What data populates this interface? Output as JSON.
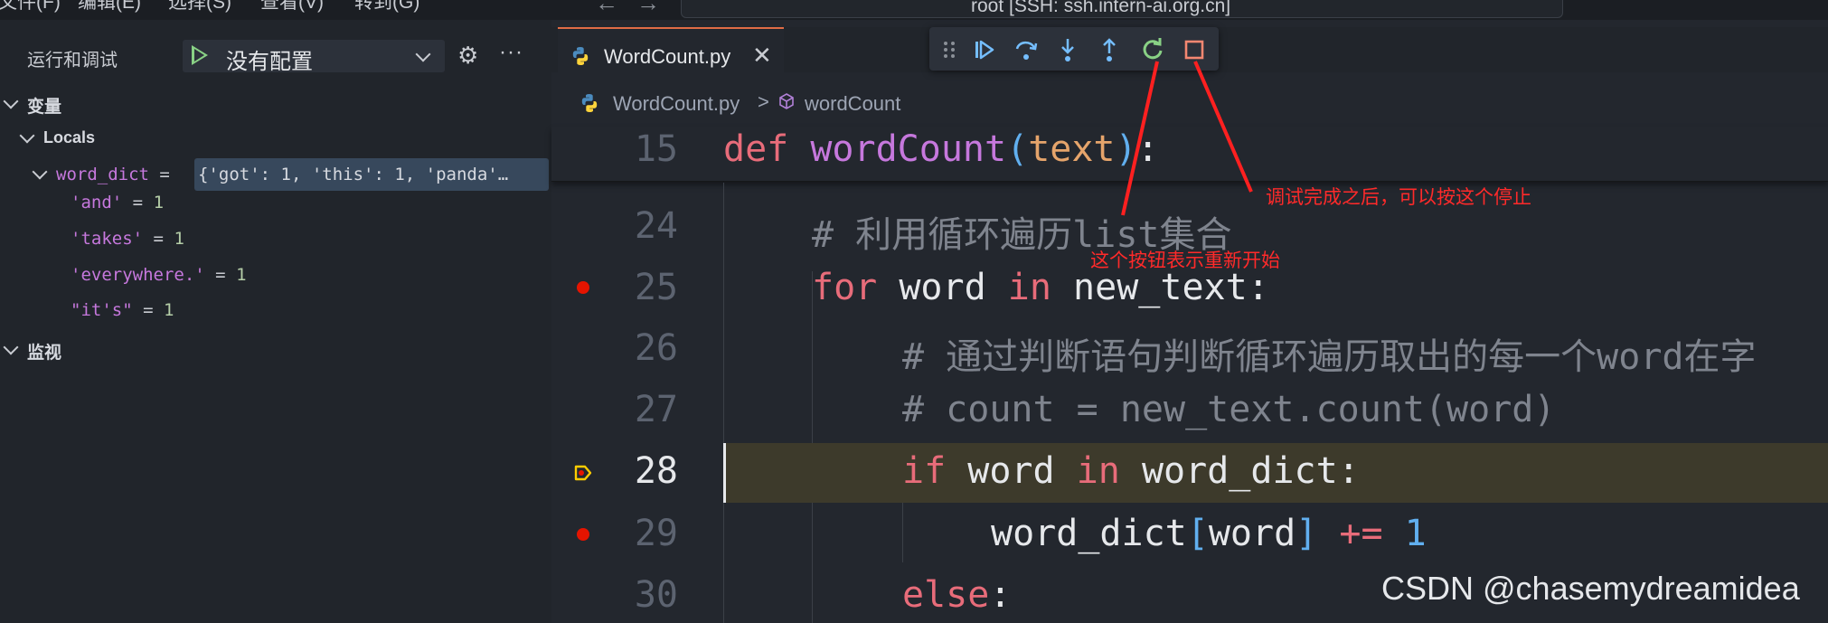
{
  "menubar": {
    "items": [
      "文件(F)",
      "编辑(E)",
      "选择(S)",
      "查看(V)",
      "转到(G)"
    ],
    "more": "···",
    "search": "root [SSH: ssh.intern-ai.org.cn]"
  },
  "sidebar": {
    "title": "运行和调试",
    "config_label": "没有配置",
    "sections": {
      "variables": "变量",
      "locals": "Locals",
      "watch": "监视"
    },
    "variables": [
      {
        "name": "word_dict",
        "eq": "=",
        "value": "{'got': 1, 'this': 1, 'panda'…"
      },
      {
        "name": "'and'",
        "eq": "=",
        "value": "1"
      },
      {
        "name": "'takes'",
        "eq": "=",
        "value": "1"
      },
      {
        "name": "'everywhere.'",
        "eq": "=",
        "value": "1"
      },
      {
        "name": "\"it's\"",
        "eq": "=",
        "value": "1"
      }
    ]
  },
  "editor": {
    "tab_label": "WordCount.py",
    "breadcrumb": {
      "file": "WordCount.py",
      "separator": ">",
      "symbol": "wordCount"
    },
    "lines": [
      {
        "num": "15"
      },
      {
        "num": "24"
      },
      {
        "num": "25"
      },
      {
        "num": "26"
      },
      {
        "num": "27"
      },
      {
        "num": "28"
      },
      {
        "num": "29"
      },
      {
        "num": "30"
      }
    ],
    "code": {
      "l15": {
        "kw": "def",
        "fn": "wordCount",
        "open": "(",
        "param": "text",
        "close": ")",
        "colon": ":"
      },
      "l24": "# 利用循环遍历list集合",
      "l25": {
        "kw": "for",
        "a": "word",
        "in": "in",
        "b": "new_text:"
      },
      "l26": "# 通过判断语句判断循环遍历取出的每一个word在字",
      "l27": "# count = new_text.count(word)",
      "l28": {
        "kw": "if",
        "a": "word",
        "in": "in",
        "b": "word_dict:"
      },
      "l29": {
        "a": "word_dict",
        "open": "[",
        "b": "word",
        "close": "]",
        "op": "+=",
        "num": "1"
      },
      "l30": {
        "kw": "else",
        "colon": ":"
      }
    }
  },
  "annotations": {
    "stop_note": "调试完成之后，可以按这个停止",
    "restart_note": "这个按钮表示重新开始"
  },
  "watermark": "CSDN @chasemydreamidea",
  "colors": {
    "annotation": "#ff2a2a",
    "accent": "#e06c45",
    "restart": "#89d185",
    "debug_blue": "#75beff"
  }
}
